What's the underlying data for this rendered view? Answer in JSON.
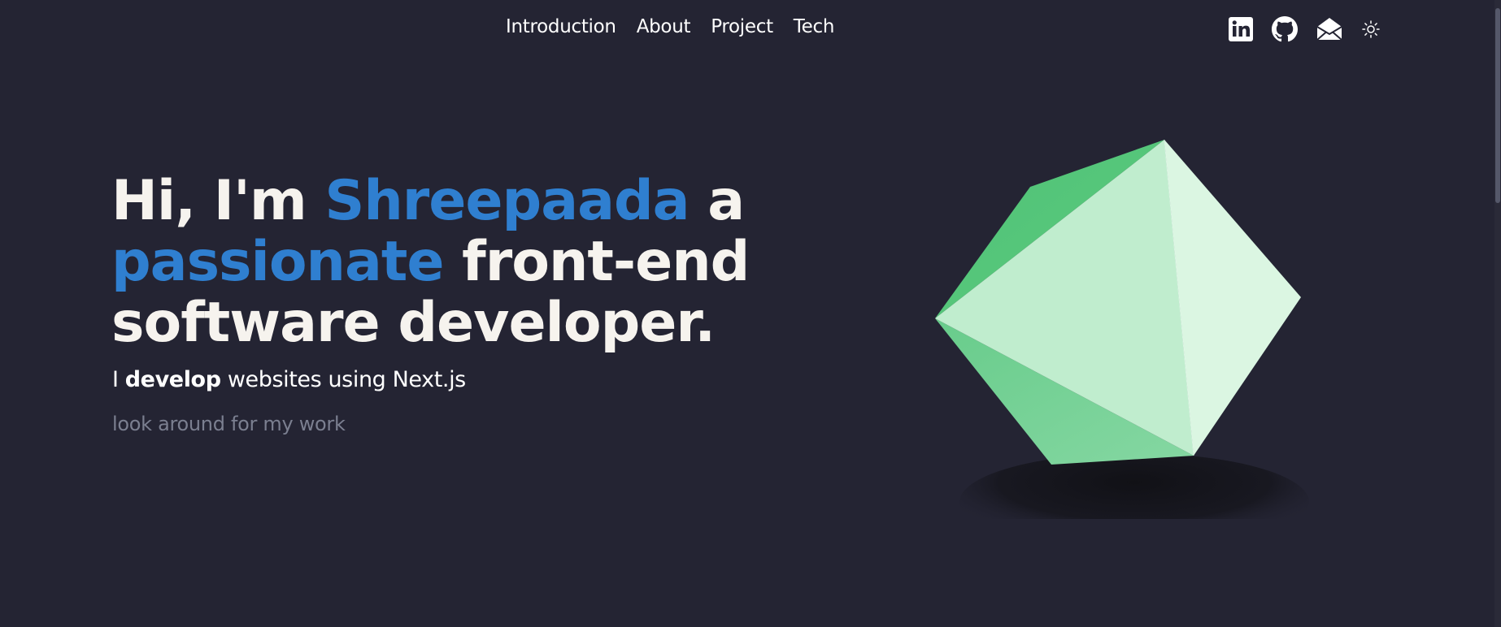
{
  "nav": {
    "items": [
      "Introduction",
      "About",
      "Project",
      "Tech"
    ]
  },
  "socials": {
    "icons": [
      "linkedin-icon",
      "github-icon",
      "mail-icon",
      "sun-icon"
    ]
  },
  "hero": {
    "greeting": "Hi, I'm ",
    "name": "Shreepaada",
    "connector": " a ",
    "adjective": "passionate",
    "role": " front-end software developer.",
    "sub_prefix": "I ",
    "sub_bold": "develop",
    "sub_suffix": " websites using Next.js",
    "hint": "look around for my work"
  },
  "colors": {
    "background": "#242433",
    "accent": "#2f7fd0",
    "heading": "#f6f3ee",
    "hint": "#7b7f90",
    "gem": "#5ccb80"
  }
}
